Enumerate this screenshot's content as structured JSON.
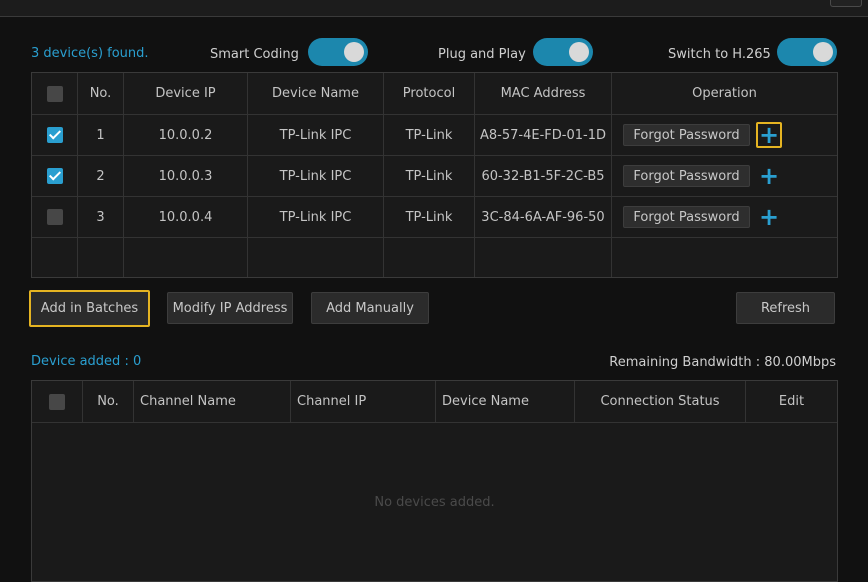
{
  "found_text": "3 device(s) found.",
  "toggles": {
    "smart_coding": {
      "label": "Smart Coding",
      "on": true
    },
    "plug_and_play": {
      "label": "Plug and Play",
      "on": true
    },
    "h265": {
      "label": "Switch to H.265",
      "on": true
    }
  },
  "devices_table": {
    "headers": [
      "No.",
      "Device IP",
      "Device Name",
      "Protocol",
      "MAC Address",
      "Operation"
    ],
    "rows": [
      {
        "checked": true,
        "no": "1",
        "ip": "10.0.0.2",
        "name": "TP-Link IPC",
        "protocol": "TP-Link",
        "mac": "A8-57-4E-FD-01-1D"
      },
      {
        "checked": true,
        "no": "2",
        "ip": "10.0.0.3",
        "name": "TP-Link IPC",
        "protocol": "TP-Link",
        "mac": "60-32-B1-5F-2C-B5"
      },
      {
        "checked": false,
        "no": "3",
        "ip": "10.0.0.4",
        "name": "TP-Link IPC",
        "protocol": "TP-Link",
        "mac": "3C-84-6A-AF-96-50"
      }
    ],
    "forgot_label": "Forgot Password"
  },
  "actions": {
    "add_batches": "Add in Batches",
    "modify_ip": "Modify IP Address",
    "add_manually": "Add Manually",
    "refresh": "Refresh"
  },
  "added": {
    "title": "Device added : 0",
    "bandwidth": "Remaining Bandwidth : 80.00Mbps",
    "headers": [
      "No.",
      "Channel Name",
      "Channel IP",
      "Device Name",
      "Connection Status",
      "Edit"
    ],
    "empty": "No devices added."
  },
  "colors": {
    "accent": "#2a9fd0",
    "highlight": "#e5b422",
    "background": "#111111"
  }
}
